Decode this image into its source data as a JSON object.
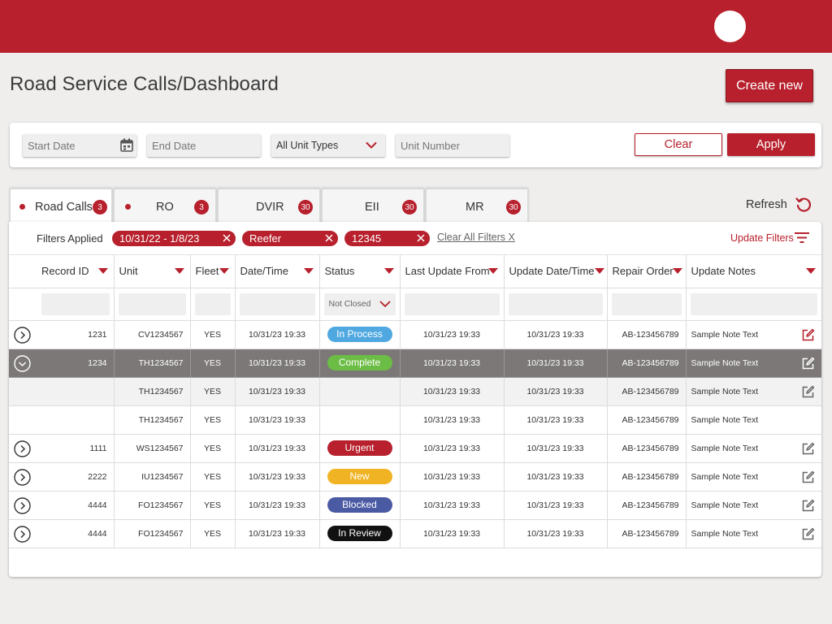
{
  "page": {
    "title": "Road Service Calls/Dashboard",
    "create_label": "Create new"
  },
  "filters": {
    "start_date_placeholder": "Start Date",
    "end_date_placeholder": "End Date",
    "unit_types_value": "All Unit Types",
    "unit_number_placeholder": "Unit Number",
    "clear_label": "Clear",
    "apply_label": "Apply"
  },
  "tabs": [
    {
      "label": "Road Calls",
      "badge": "3"
    },
    {
      "label": "RO",
      "badge": "3"
    },
    {
      "label": "DVIR",
      "badge": "30"
    },
    {
      "label": "EII",
      "badge": "30"
    },
    {
      "label": "MR",
      "badge": "30"
    }
  ],
  "refresh_label": "Refresh",
  "applied": {
    "label": "Filters Applied",
    "chips": [
      "10/31/22 - 1/8/23",
      "Reefer",
      "12345"
    ],
    "clear_all": "Clear All Filters X",
    "update_filters": "Update Filters"
  },
  "columns": [
    "Record ID",
    "Unit",
    "Fleet",
    "Date/Time",
    "Status",
    "Last Update From",
    "Update Date/Time",
    "Repair Order",
    "Update Notes"
  ],
  "status_filter_value": "Not Closed",
  "colors": {
    "brand": "#b7202c",
    "in_process": "#4fa8e0",
    "complete": "#6cbd45",
    "urgent": "#b7202c",
    "new": "#f0b323",
    "blocked": "#4a5aa3",
    "in_review": "#111111"
  },
  "rows": [
    {
      "id": "1231",
      "unit": "CV1234567",
      "fleet": "YES",
      "dt": "10/31/23 19:33",
      "status": "In Process",
      "last": "10/31/23 19:33",
      "upd": "10/31/23 19:33",
      "ro": "AB-123456789",
      "notes": "Sample Note Text"
    },
    {
      "id": "1234",
      "unit": "TH1234567",
      "fleet": "YES",
      "dt": "10/31/23 19:33",
      "status": "Complete",
      "last": "10/31/23 19:33",
      "upd": "10/31/23 19:33",
      "ro": "AB-123456789",
      "notes": "Sample Note Text"
    },
    {
      "id": "",
      "unit": "TH1234567",
      "fleet": "YES",
      "dt": "10/31/23 19:33",
      "status": "",
      "last": "10/31/23 19:33",
      "upd": "10/31/23 19:33",
      "ro": "AB-123456789",
      "notes": "Sample Note Text"
    },
    {
      "id": "",
      "unit": "TH1234567",
      "fleet": "YES",
      "dt": "10/31/23 19:33",
      "status": "",
      "last": "10/31/23 19:33",
      "upd": "10/31/23 19:33",
      "ro": "AB-123456789",
      "notes": "Sample Note Text"
    },
    {
      "id": "1111",
      "unit": "WS1234567",
      "fleet": "YES",
      "dt": "10/31/23 19:33",
      "status": "Urgent",
      "last": "10/31/23 19:33",
      "upd": "10/31/23 19:33",
      "ro": "AB-123456789",
      "notes": "Sample Note Text"
    },
    {
      "id": "2222",
      "unit": "IU1234567",
      "fleet": "YES",
      "dt": "10/31/23 19:33",
      "status": "New",
      "last": "10/31/23 19:33",
      "upd": "10/31/23 19:33",
      "ro": "AB-123456789",
      "notes": "Sample Note Text"
    },
    {
      "id": "4444",
      "unit": "FO1234567",
      "fleet": "YES",
      "dt": "10/31/23 19:33",
      "status": "Blocked",
      "last": "10/31/23 19:33",
      "upd": "10/31/23 19:33",
      "ro": "AB-123456789",
      "notes": "Sample Note Text"
    },
    {
      "id": "4444",
      "unit": "FO1234567",
      "fleet": "YES",
      "dt": "10/31/23 19:33",
      "status": "In Review",
      "last": "10/31/23 19:33",
      "upd": "10/31/23 19:33",
      "ro": "AB-123456789",
      "notes": "Sample Note Text"
    }
  ]
}
